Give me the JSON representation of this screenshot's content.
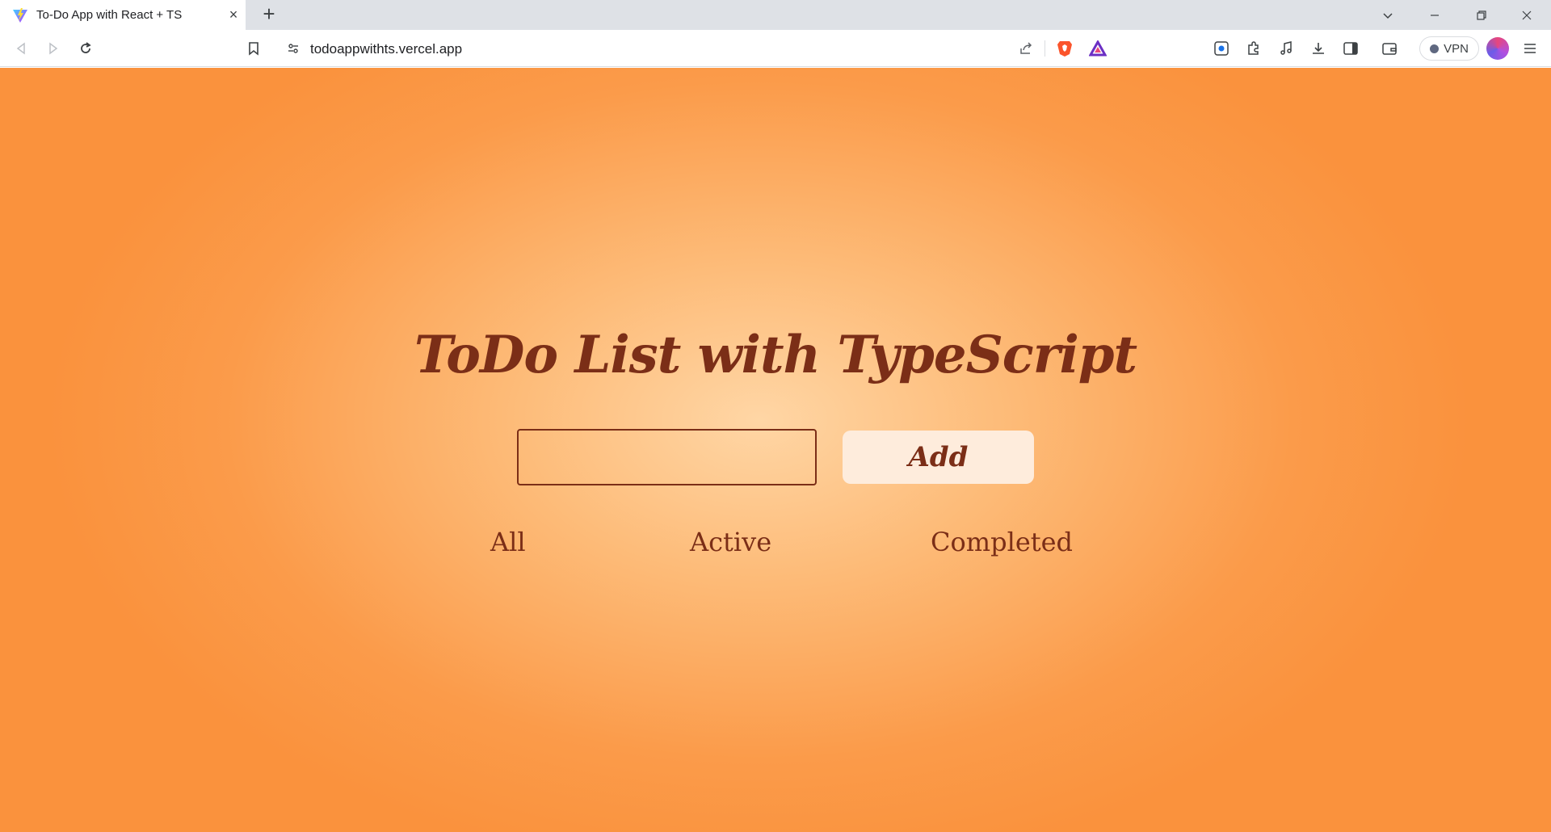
{
  "browser": {
    "tab_title": "To-Do App with React + TS",
    "url": "todoappwithts.vercel.app",
    "vpn_label": "VPN"
  },
  "app": {
    "heading": "ToDo List with TypeScript",
    "input_value": "",
    "add_label": "Add",
    "filters": {
      "all": "All",
      "active": "Active",
      "completed": "Completed"
    }
  },
  "colors": {
    "accent": "#7b2e17",
    "background_center": "#ffd6a5",
    "background_edge": "#fa923d",
    "button_bg": "#feecdc"
  }
}
